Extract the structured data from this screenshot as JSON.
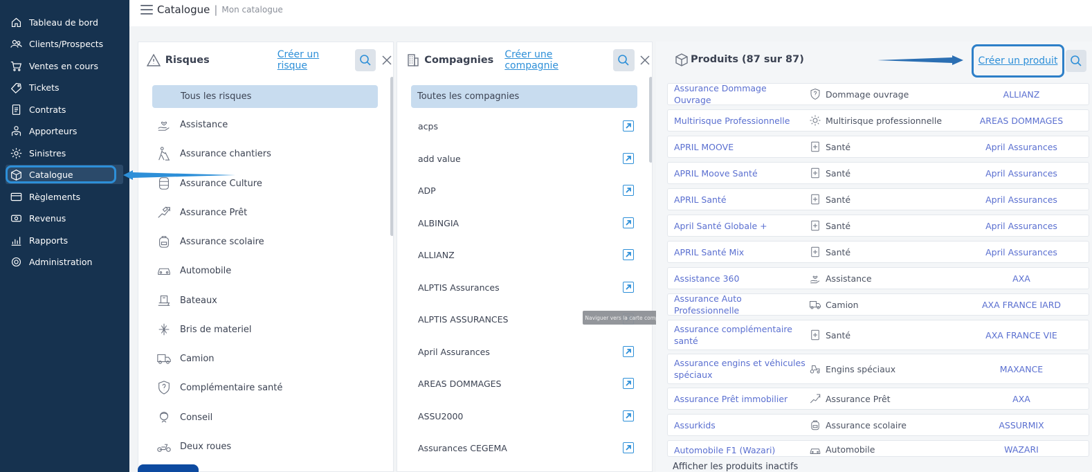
{
  "sidebar": {
    "items": [
      {
        "label": "Tableau de bord",
        "icon": "home-icon"
      },
      {
        "label": "Clients/Prospects",
        "icon": "users-icon"
      },
      {
        "label": "Ventes en cours",
        "icon": "cart-icon"
      },
      {
        "label": "Tickets",
        "icon": "ticket-icon"
      },
      {
        "label": "Contrats",
        "icon": "contract-icon"
      },
      {
        "label": "Apporteurs",
        "icon": "handshake-icon"
      },
      {
        "label": "Sinistres",
        "icon": "cog-icon"
      },
      {
        "label": "Catalogue",
        "icon": "box-icon",
        "active": true
      },
      {
        "label": "Règlements",
        "icon": "card-icon"
      },
      {
        "label": "Revenus",
        "icon": "money-icon"
      },
      {
        "label": "Rapports",
        "icon": "chart-icon"
      },
      {
        "label": "Administration",
        "icon": "settings-icon"
      }
    ]
  },
  "header": {
    "title": "Catalogue",
    "separator": "|",
    "subtitle": "Mon catalogue"
  },
  "risques": {
    "title": "Risques",
    "create_label": "Créer un risque",
    "all_label": "Tous les risques",
    "items": [
      "Assistance",
      "Assurance chantiers",
      "Assurance Culture",
      "Assurance Prêt",
      "Assurance scolaire",
      "Automobile",
      "Bateaux",
      "Bris de materiel",
      "Camion",
      "Complémentaire santé",
      "Conseil",
      "Deux roues"
    ]
  },
  "compagnies": {
    "title": "Compagnies",
    "create_label": "Créer une compagnie",
    "all_label": "Toutes les compagnies",
    "items": [
      "acps",
      "add value",
      "ADP",
      "ALBINGIA",
      "ALLIANZ",
      "ALPTIS Assurances",
      "ALPTIS ASSURANCES",
      "April Assurances",
      "AREAS DOMMAGES",
      "ASSU2000",
      "Assurances CEGEMA"
    ],
    "tooltip": "Naviguer vers la carte compagnie"
  },
  "produits": {
    "title": "Produits (87 sur 87)",
    "create_label": "Créer un produit",
    "inactive_label": "Afficher les produits inactifs",
    "rows": [
      {
        "name": "Assurance Dommage Ouvrage",
        "risk": "Dommage ouvrage",
        "company": "ALLIANZ",
        "icon": "shield-question-icon"
      },
      {
        "name": "Multirisque Professionnelle",
        "risk": "Multirisque professionnelle",
        "company": "AREAS DOMMAGES",
        "icon": "sun-icon"
      },
      {
        "name": "APRIL MOOVE",
        "risk": "Santé",
        "company": "April Assurances",
        "icon": "health-icon"
      },
      {
        "name": "APRIL Moove Santé",
        "risk": "Santé",
        "company": "April Assurances",
        "icon": "health-icon"
      },
      {
        "name": "APRIL Santé",
        "risk": "Santé",
        "company": "April Assurances",
        "icon": "health-icon"
      },
      {
        "name": "April Santé Globale +",
        "risk": "Santé",
        "company": "April Assurances",
        "icon": "health-icon"
      },
      {
        "name": "APRIL Santé Mix",
        "risk": "Santé",
        "company": "April Assurances",
        "icon": "health-icon"
      },
      {
        "name": "Assistance 360",
        "risk": "Assistance",
        "company": "AXA",
        "icon": "hand-heart-icon"
      },
      {
        "name": "Assurance Auto Professionnelle",
        "risk": "Camion",
        "company": "AXA FRANCE IARD",
        "icon": "truck-icon"
      },
      {
        "name": "Assurance complémentaire santé",
        "risk": "Santé",
        "company": "AXA FRANCE VIE",
        "icon": "health-icon"
      },
      {
        "name": "Assurance engins et véhicules spéciaux",
        "risk": "Engins spéciaux",
        "company": "MAXANCE",
        "icon": "tractor-icon"
      },
      {
        "name": "Assurance Prêt immobilier",
        "risk": "Assurance Prêt",
        "company": "AXA",
        "icon": "money-hand-icon"
      },
      {
        "name": "Assurkids",
        "risk": "Assurance scolaire",
        "company": "ASSURMIX",
        "icon": "backpack-icon"
      },
      {
        "name": "Automobile F1 (Wazari)",
        "risk": "Automobile",
        "company": "WAZARI",
        "icon": "car-icon"
      }
    ]
  }
}
